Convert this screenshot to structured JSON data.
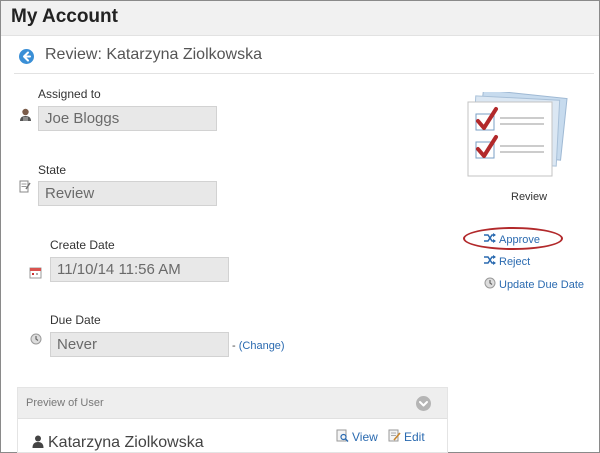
{
  "header": {
    "title": "My Account"
  },
  "review": {
    "title": "Review: Katarzyna Ziolkowska"
  },
  "fields": {
    "assigned_to": {
      "label": "Assigned to",
      "value": "Joe Bloggs"
    },
    "state": {
      "label": "State",
      "value": "Review"
    },
    "create_date": {
      "label": "Create Date",
      "value": "11/10/14 11:56 AM"
    },
    "due_date": {
      "label": "Due Date",
      "value": "Never",
      "change_prefix": "- ",
      "change_label": "(Change)"
    }
  },
  "workflow": {
    "caption": "Review",
    "actions": [
      {
        "label": "Approve",
        "icon": "shuffle-icon"
      },
      {
        "label": "Reject",
        "icon": "shuffle-icon"
      },
      {
        "label": "Update Due Date",
        "icon": "clock-icon"
      }
    ]
  },
  "preview": {
    "title": "Preview of User",
    "user_name": "Katarzyna Ziolkowska",
    "view_label": "View",
    "edit_label": "Edit"
  },
  "colors": {
    "link": "#2a6ab0",
    "accent": "#3a8fd6",
    "highlight_oval": "#b2292b",
    "field_bg": "#e8e8e8"
  }
}
